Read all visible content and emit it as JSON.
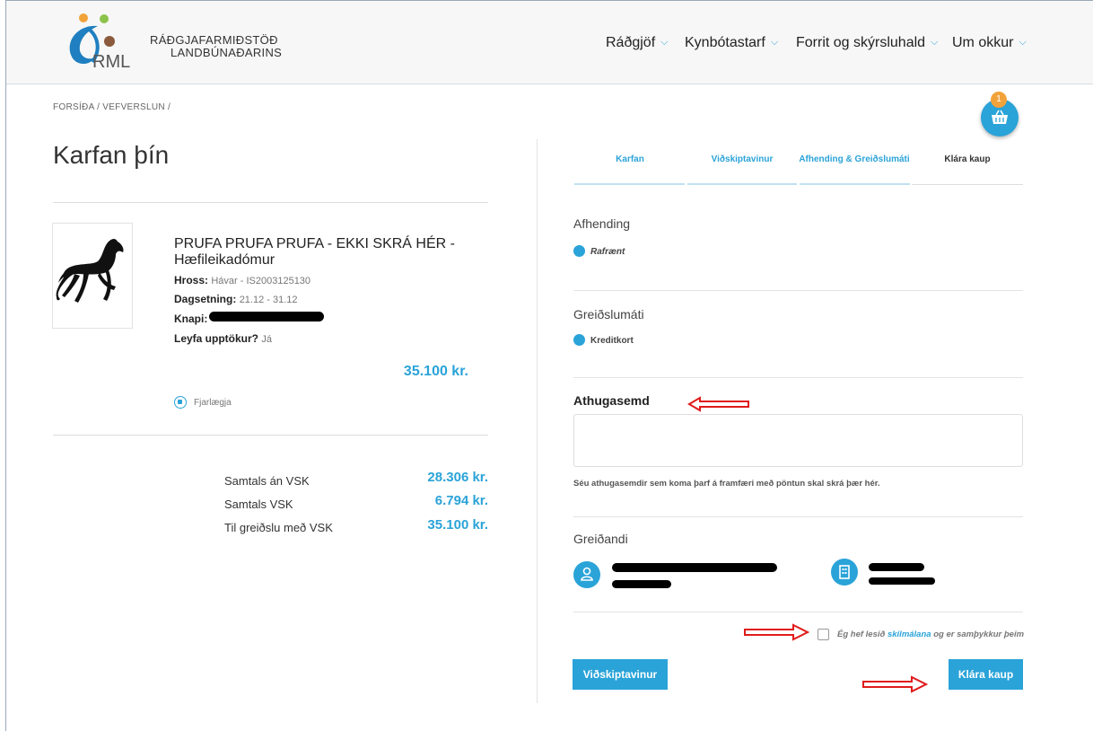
{
  "header": {
    "logo_name": "RÁÐGJAFARMIÐSTÖÐ",
    "logo_sub": "LANDBÚNAÐARINS",
    "logo_mark": "RML",
    "nav": [
      {
        "label": "Ráðgjöf"
      },
      {
        "label": "Kynbótastarf"
      },
      {
        "label": "Forrit og skýrsluhald"
      },
      {
        "label": "Um okkur"
      }
    ]
  },
  "breadcrumb": "FORSÍÐA  /  VEFVERSLUN  /",
  "cart": {
    "count": "1"
  },
  "page_title": "Karfan þín",
  "product": {
    "title": "PRUFA PRUFA PRUFA - EKKI SKRÁ HÉR - Hæfileikadómur",
    "horse_label": "Hross:",
    "horse_value": "Hávar - IS2003125130",
    "date_label": "Dagsetning:",
    "date_value": "21.12 - 31.12",
    "rider_label": "Knapi:",
    "record_label": "Leyfa upptökur?",
    "record_value": "Já",
    "price": "35.100 kr.",
    "remove_label": "Fjarlægja"
  },
  "totals": [
    {
      "label": "Samtals án VSK",
      "value": "28.306 kr."
    },
    {
      "label": "Samtals VSK",
      "value": "6.794 kr."
    },
    {
      "label": "Til greiðslu með VSK",
      "value": "35.100 kr."
    }
  ],
  "steps": [
    {
      "label": "Karfan"
    },
    {
      "label": "Viðskiptavinur"
    },
    {
      "label": "Afhending & Greiðslumáti"
    },
    {
      "label": "Klára kaup"
    }
  ],
  "delivery": {
    "title": "Afhending",
    "option": "Rafrænt"
  },
  "payment": {
    "title": "Greiðslumáti",
    "option": "Kreditkort"
  },
  "note": {
    "title": "Athugasemd",
    "hint": "Séu athugasemdir sem koma þarf á framfæri með pöntun skal skrá þær hér."
  },
  "payer": {
    "title": "Greiðandi"
  },
  "terms": {
    "prefix": "Ég hef lesið ",
    "link": "skilmálana",
    "suffix": " og er samþykkur þeim"
  },
  "buttons": {
    "back": "Viðskiptavinur",
    "finish": "Klára kaup"
  },
  "colors": {
    "accent": "#2aa3d8",
    "badge": "#f2a23a",
    "annotation": "#e01b1b"
  }
}
